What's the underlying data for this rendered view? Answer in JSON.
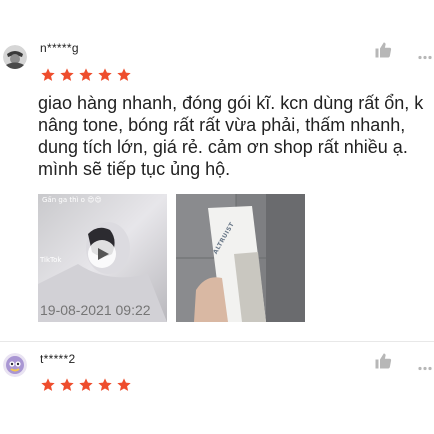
{
  "reviews": [
    {
      "username": "n*****g",
      "rating": 5,
      "comment_lines": [
        "giao hàng nhanh, đóng gói kĩ. kcn dùng rất ổn, k",
        "nâng tone, bóng rất rất vừa phải, thấm nhanh,",
        "dung tích lớn, giá rẻ. cảm ơn shop rất nhiều ạ.",
        "mình sẽ tiếp tục ủng hộ."
      ],
      "video_caption": "Gấn ga thì o 😍😍",
      "video_watermark": "TikTok",
      "product_brand": "ALTRUIST",
      "timestamp": "19-08-2021 09:22"
    },
    {
      "username": "t*****2",
      "rating": 5
    }
  ],
  "icons": {
    "star": "star-icon",
    "like": "thumbs-up-icon",
    "more": "more-dots-icon",
    "play": "play-icon"
  },
  "colors": {
    "star": "#ee4d2d",
    "icon_gray": "#b7b7b7",
    "text": "#222222",
    "muted": "#757575"
  }
}
